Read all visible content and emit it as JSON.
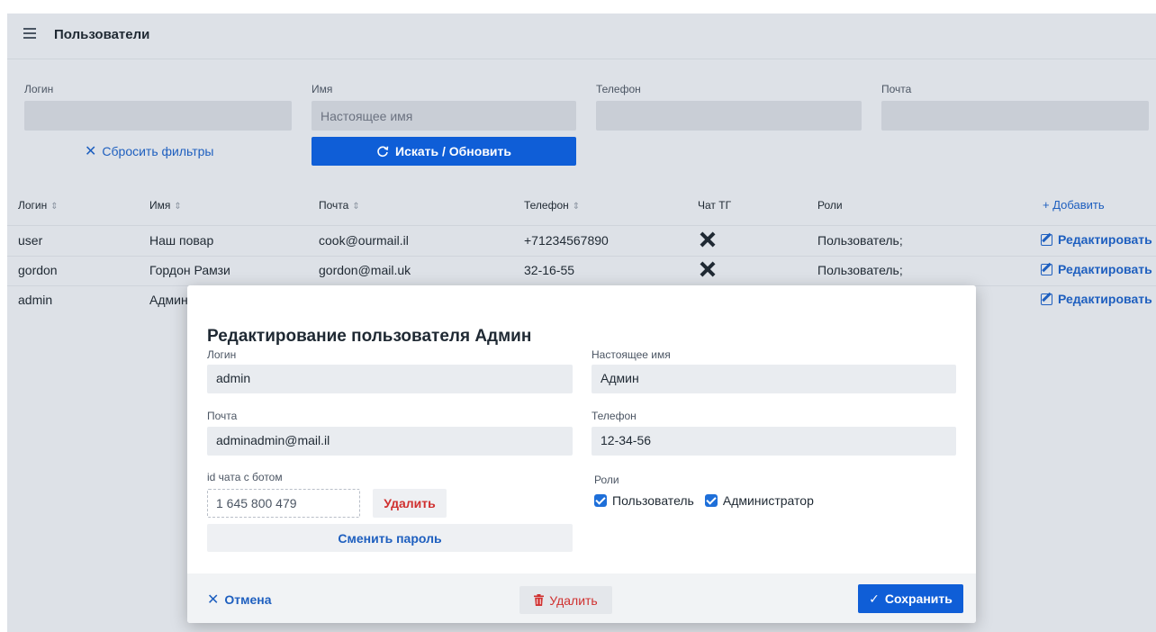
{
  "header": {
    "title": "Пользователи"
  },
  "filters": {
    "login_label": "Логин",
    "name_label": "Имя",
    "name_placeholder": "Настоящее имя",
    "phone_label": "Телефон",
    "mail_label": "Почта",
    "reset_label": "Сбросить фильтры",
    "search_label": "Искать / Обновить"
  },
  "table": {
    "columns": [
      "Логин",
      "Имя",
      "Почта",
      "Телефон",
      "Чат ТГ",
      "Роли"
    ],
    "add_label": "+ Добавить",
    "edit_label": "Редактировать",
    "rows": [
      {
        "login": "user",
        "name": "Наш повар",
        "mail": "cook@ourmail.il",
        "phone": "+71234567890",
        "roles": "Пользователь;"
      },
      {
        "login": "gordon",
        "name": "Гордон Рамзи",
        "mail": "gordon@mail.uk",
        "phone": "32-16-55",
        "roles": "Пользователь;"
      },
      {
        "login": "admin",
        "name": "Админ"
      }
    ]
  },
  "modal": {
    "title": "Редактирование пользователя Админ",
    "login_label": "Логин",
    "login_value": "admin",
    "realname_label": "Настоящее имя",
    "realname_value": "Админ",
    "mail_label": "Почта",
    "mail_value": "adminadmin@mail.il",
    "phone_label": "Телефон",
    "phone_value": "12-34-56",
    "chat_label": "id чата с ботом",
    "chat_value": "1 645 800 479",
    "chat_delete": "Удалить",
    "change_password": "Сменить пароль",
    "roles_label": "Роли",
    "role_user": "Пользователь",
    "role_admin": "Администратор",
    "cancel": "Отмена",
    "delete": "Удалить",
    "save": "Сохранить"
  },
  "colors": {
    "primary": "#0f5ed7",
    "danger": "#d0302f",
    "background": "#dde1e7"
  }
}
